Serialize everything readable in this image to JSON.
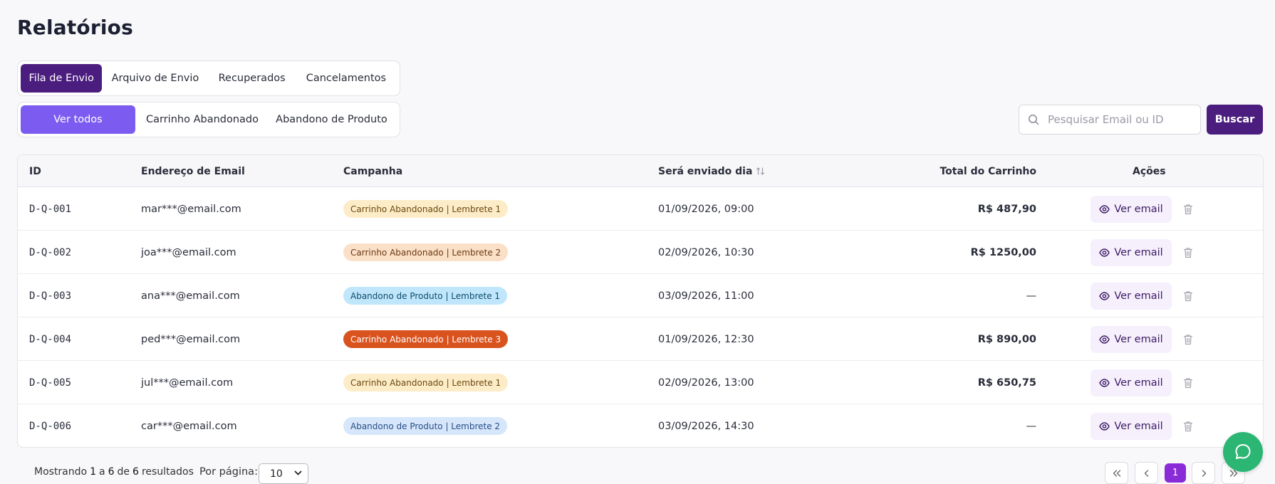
{
  "page": {
    "title": "Relatórios"
  },
  "tabs_primary": [
    {
      "label": "Fila de Envio",
      "active": true
    },
    {
      "label": "Arquivo de Envio",
      "active": false
    },
    {
      "label": "Recuperados",
      "active": false
    },
    {
      "label": "Cancelamentos",
      "active": false
    }
  ],
  "tabs_filter": [
    {
      "label": "Ver todos",
      "active": true
    },
    {
      "label": "Carrinho Abandonado",
      "active": false
    },
    {
      "label": "Abandono de Produto",
      "active": false
    }
  ],
  "search": {
    "placeholder": "Pesquisar Email ou ID",
    "value": "",
    "button_label": "Buscar",
    "icon": "search-icon"
  },
  "table": {
    "headers": {
      "id": "ID",
      "email": "Endereço de Email",
      "campaign": "Campanha",
      "date": "Será enviado dia",
      "total": "Total do Carrinho",
      "actions": "Ações"
    },
    "action_label": "Ver email",
    "rows": [
      {
        "id": "D-Q-001",
        "email": "mar***@email.com",
        "campaign": "Carrinho Abandonado | Lembrete 1",
        "badge_bg": "#fdecc8",
        "badge_fg": "#6b4a10",
        "date": "01/09/2026, 09:00",
        "total": "R$ 487,90"
      },
      {
        "id": "D-Q-002",
        "email": "joa***@email.com",
        "campaign": "Carrinho Abandonado | Lembrete 2",
        "badge_bg": "#fbe0c8",
        "badge_fg": "#6b3a12",
        "date": "02/09/2026, 10:30",
        "total": "R$ 1250,00"
      },
      {
        "id": "D-Q-003",
        "email": "ana***@email.com",
        "campaign": "Abandono de Produto | Lembrete 1",
        "badge_bg": "#bfe6fb",
        "badge_fg": "#0f4a6b",
        "date": "03/09/2026, 11:00",
        "total": "—"
      },
      {
        "id": "D-Q-004",
        "email": "ped***@email.com",
        "campaign": "Carrinho Abandonado | Lembrete 3",
        "badge_bg": "#d9531e",
        "badge_fg": "#ffffff",
        "date": "01/09/2026, 12:30",
        "total": "R$ 890,00"
      },
      {
        "id": "D-Q-005",
        "email": "jul***@email.com",
        "campaign": "Carrinho Abandonado | Lembrete 1",
        "badge_bg": "#fdecc8",
        "badge_fg": "#6b4a10",
        "date": "02/09/2026, 13:00",
        "total": "R$ 650,75"
      },
      {
        "id": "D-Q-006",
        "email": "car***@email.com",
        "campaign": "Abandono de Produto | Lembrete 2",
        "badge_bg": "#d6e6fb",
        "badge_fg": "#2a4f86",
        "date": "03/09/2026, 14:30",
        "total": "—"
      }
    ]
  },
  "footer": {
    "showing_prefix": "Mostrando",
    "from": "1",
    "to_word": "a",
    "to": "6",
    "of_word": "de",
    "total": "6",
    "suffix": "resultados",
    "per_page_label": "Por página:",
    "per_page_value": "10",
    "current_page": "1"
  },
  "colors": {
    "primary_dark": "#4b1d7e",
    "primary_light": "#7c5cf0",
    "page_active": "#8a2bd8",
    "fab": "#2bb673"
  },
  "icons": {
    "chat": "chat-bubble-icon",
    "eye": "eye-icon",
    "trash": "trash-icon",
    "sort": "sort-icon"
  }
}
